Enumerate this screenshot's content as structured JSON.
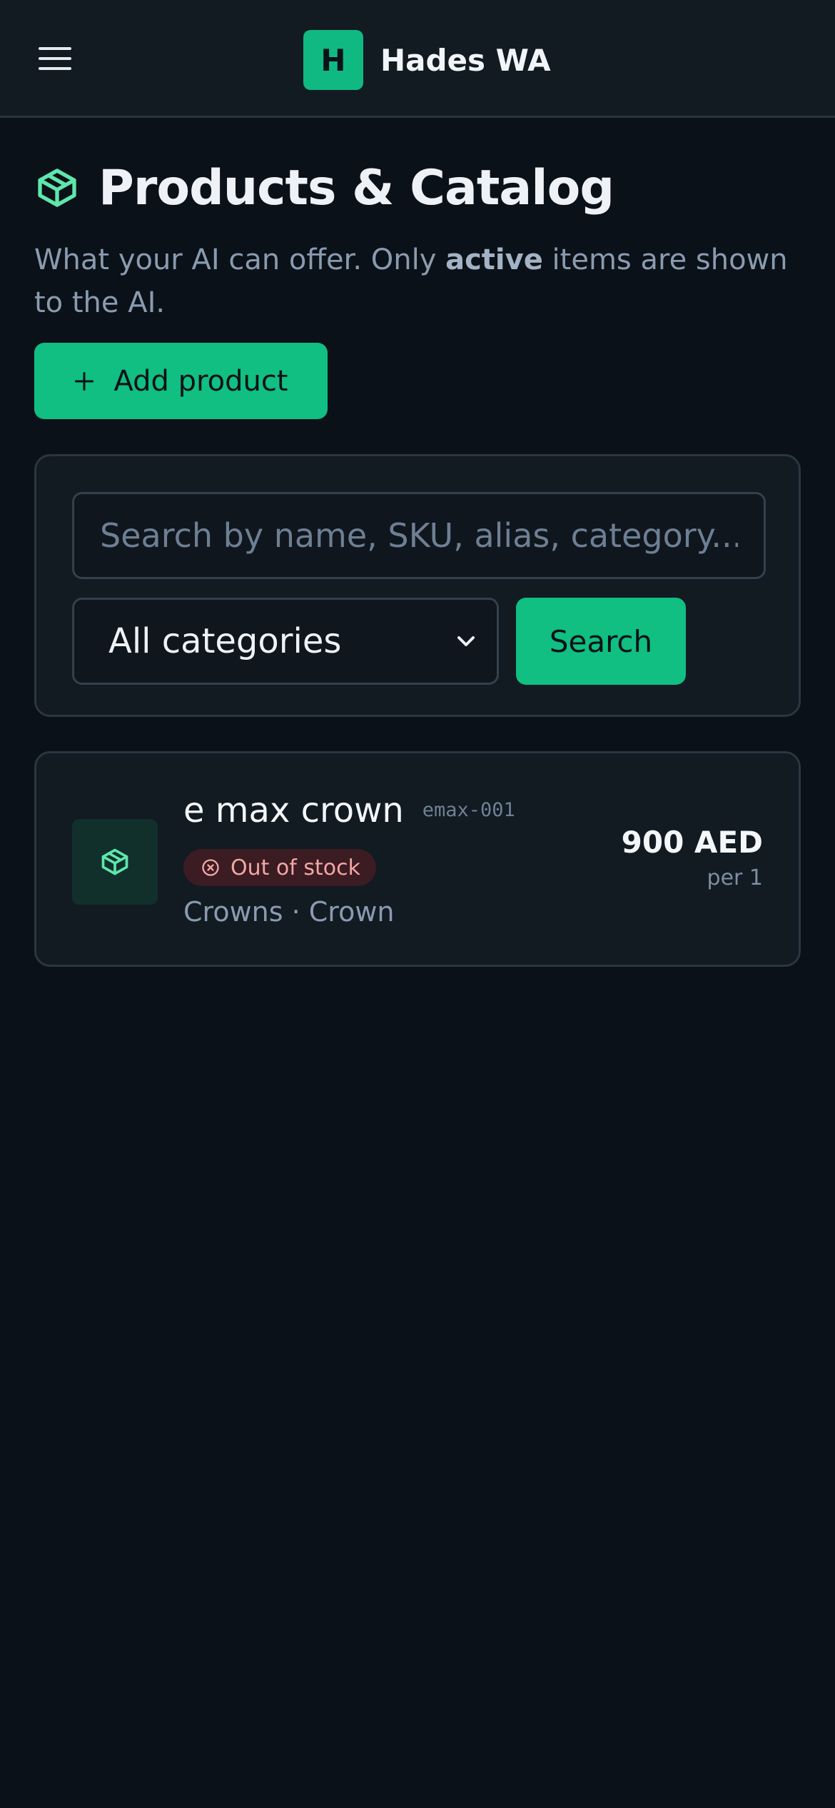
{
  "header": {
    "logo_letter": "H",
    "app_name": "Hades WA",
    "menu_icon": "hamburger-menu-icon"
  },
  "page": {
    "title": "Products & Catalog",
    "title_icon": "package-icon",
    "subtitle_before": "What your AI can offer. Only ",
    "subtitle_emphasis": "active",
    "subtitle_after": " items are shown to the AI.",
    "add_button_label": "Add product",
    "add_button_icon": "plus-icon"
  },
  "filters": {
    "search_placeholder": "Search by name, SKU, alias, category...",
    "search_value": "",
    "category_selected": "All categories",
    "category_icon": "chevron-down-icon",
    "search_button_label": "Search"
  },
  "products": [
    {
      "name": "e max crown",
      "sku": "emax-001",
      "status": "Out of stock",
      "status_icon": "x-circle-icon",
      "category": "Crowns · Crown",
      "price": "900 AED",
      "unit": "per 1",
      "thumb_icon": "package-icon"
    }
  ],
  "colors": {
    "accent": "#10bf81",
    "background": "#0b1118",
    "surface": "#121a22",
    "danger_text": "#f3a6a6",
    "danger_bg": "#3a1c22"
  }
}
